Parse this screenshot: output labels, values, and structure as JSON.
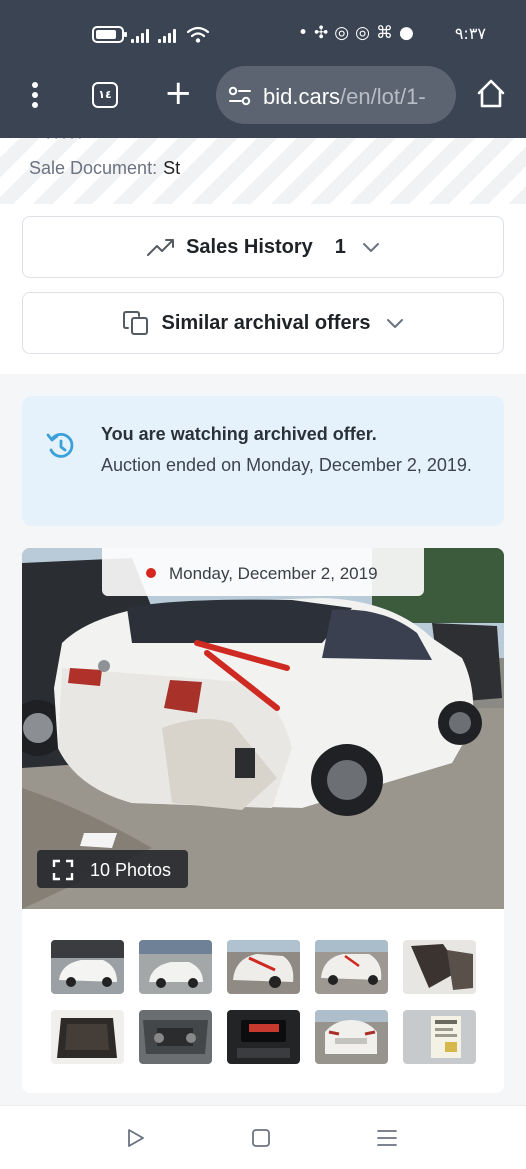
{
  "status_bar": {
    "time": "٩:٣٧",
    "battery_level": 0.85,
    "notification_icons": [
      "fan-icon",
      "whatsapp-icon",
      "whatsapp-icon",
      "drone-icon",
      "chat-icon"
    ]
  },
  "browser": {
    "tab_count": "١٤",
    "url_domain": "bid.cars",
    "url_path": "/en/lot/1-"
  },
  "sale_document": {
    "label": "Sale Document:",
    "value": "St"
  },
  "sales_history": {
    "label": "Sales History",
    "count": "1"
  },
  "similar_offers": {
    "label": "Similar archival offers"
  },
  "notice": {
    "title": "You are watching archived offer.",
    "body": "Auction ended on Monday, December 2, 2019."
  },
  "photo_card": {
    "date": "Monday, December 2, 2019",
    "photos_label": "10 Photos",
    "thumbnails": [
      "front-left-view",
      "front-view",
      "rear-damage-view",
      "rear-right-view",
      "interior-seat-view",
      "interior-rear-view",
      "engine-bay-view",
      "infotainment-view",
      "rear-view",
      "window-sticker-view"
    ]
  },
  "colors": {
    "chrome": "#3a4452",
    "accent_blue": "#3ba0da",
    "notice_bg": "#e5f2fc",
    "live_dot": "#d7261e"
  },
  "nav_bar": {
    "icons": [
      "back-icon",
      "home-icon",
      "recents-icon"
    ]
  }
}
